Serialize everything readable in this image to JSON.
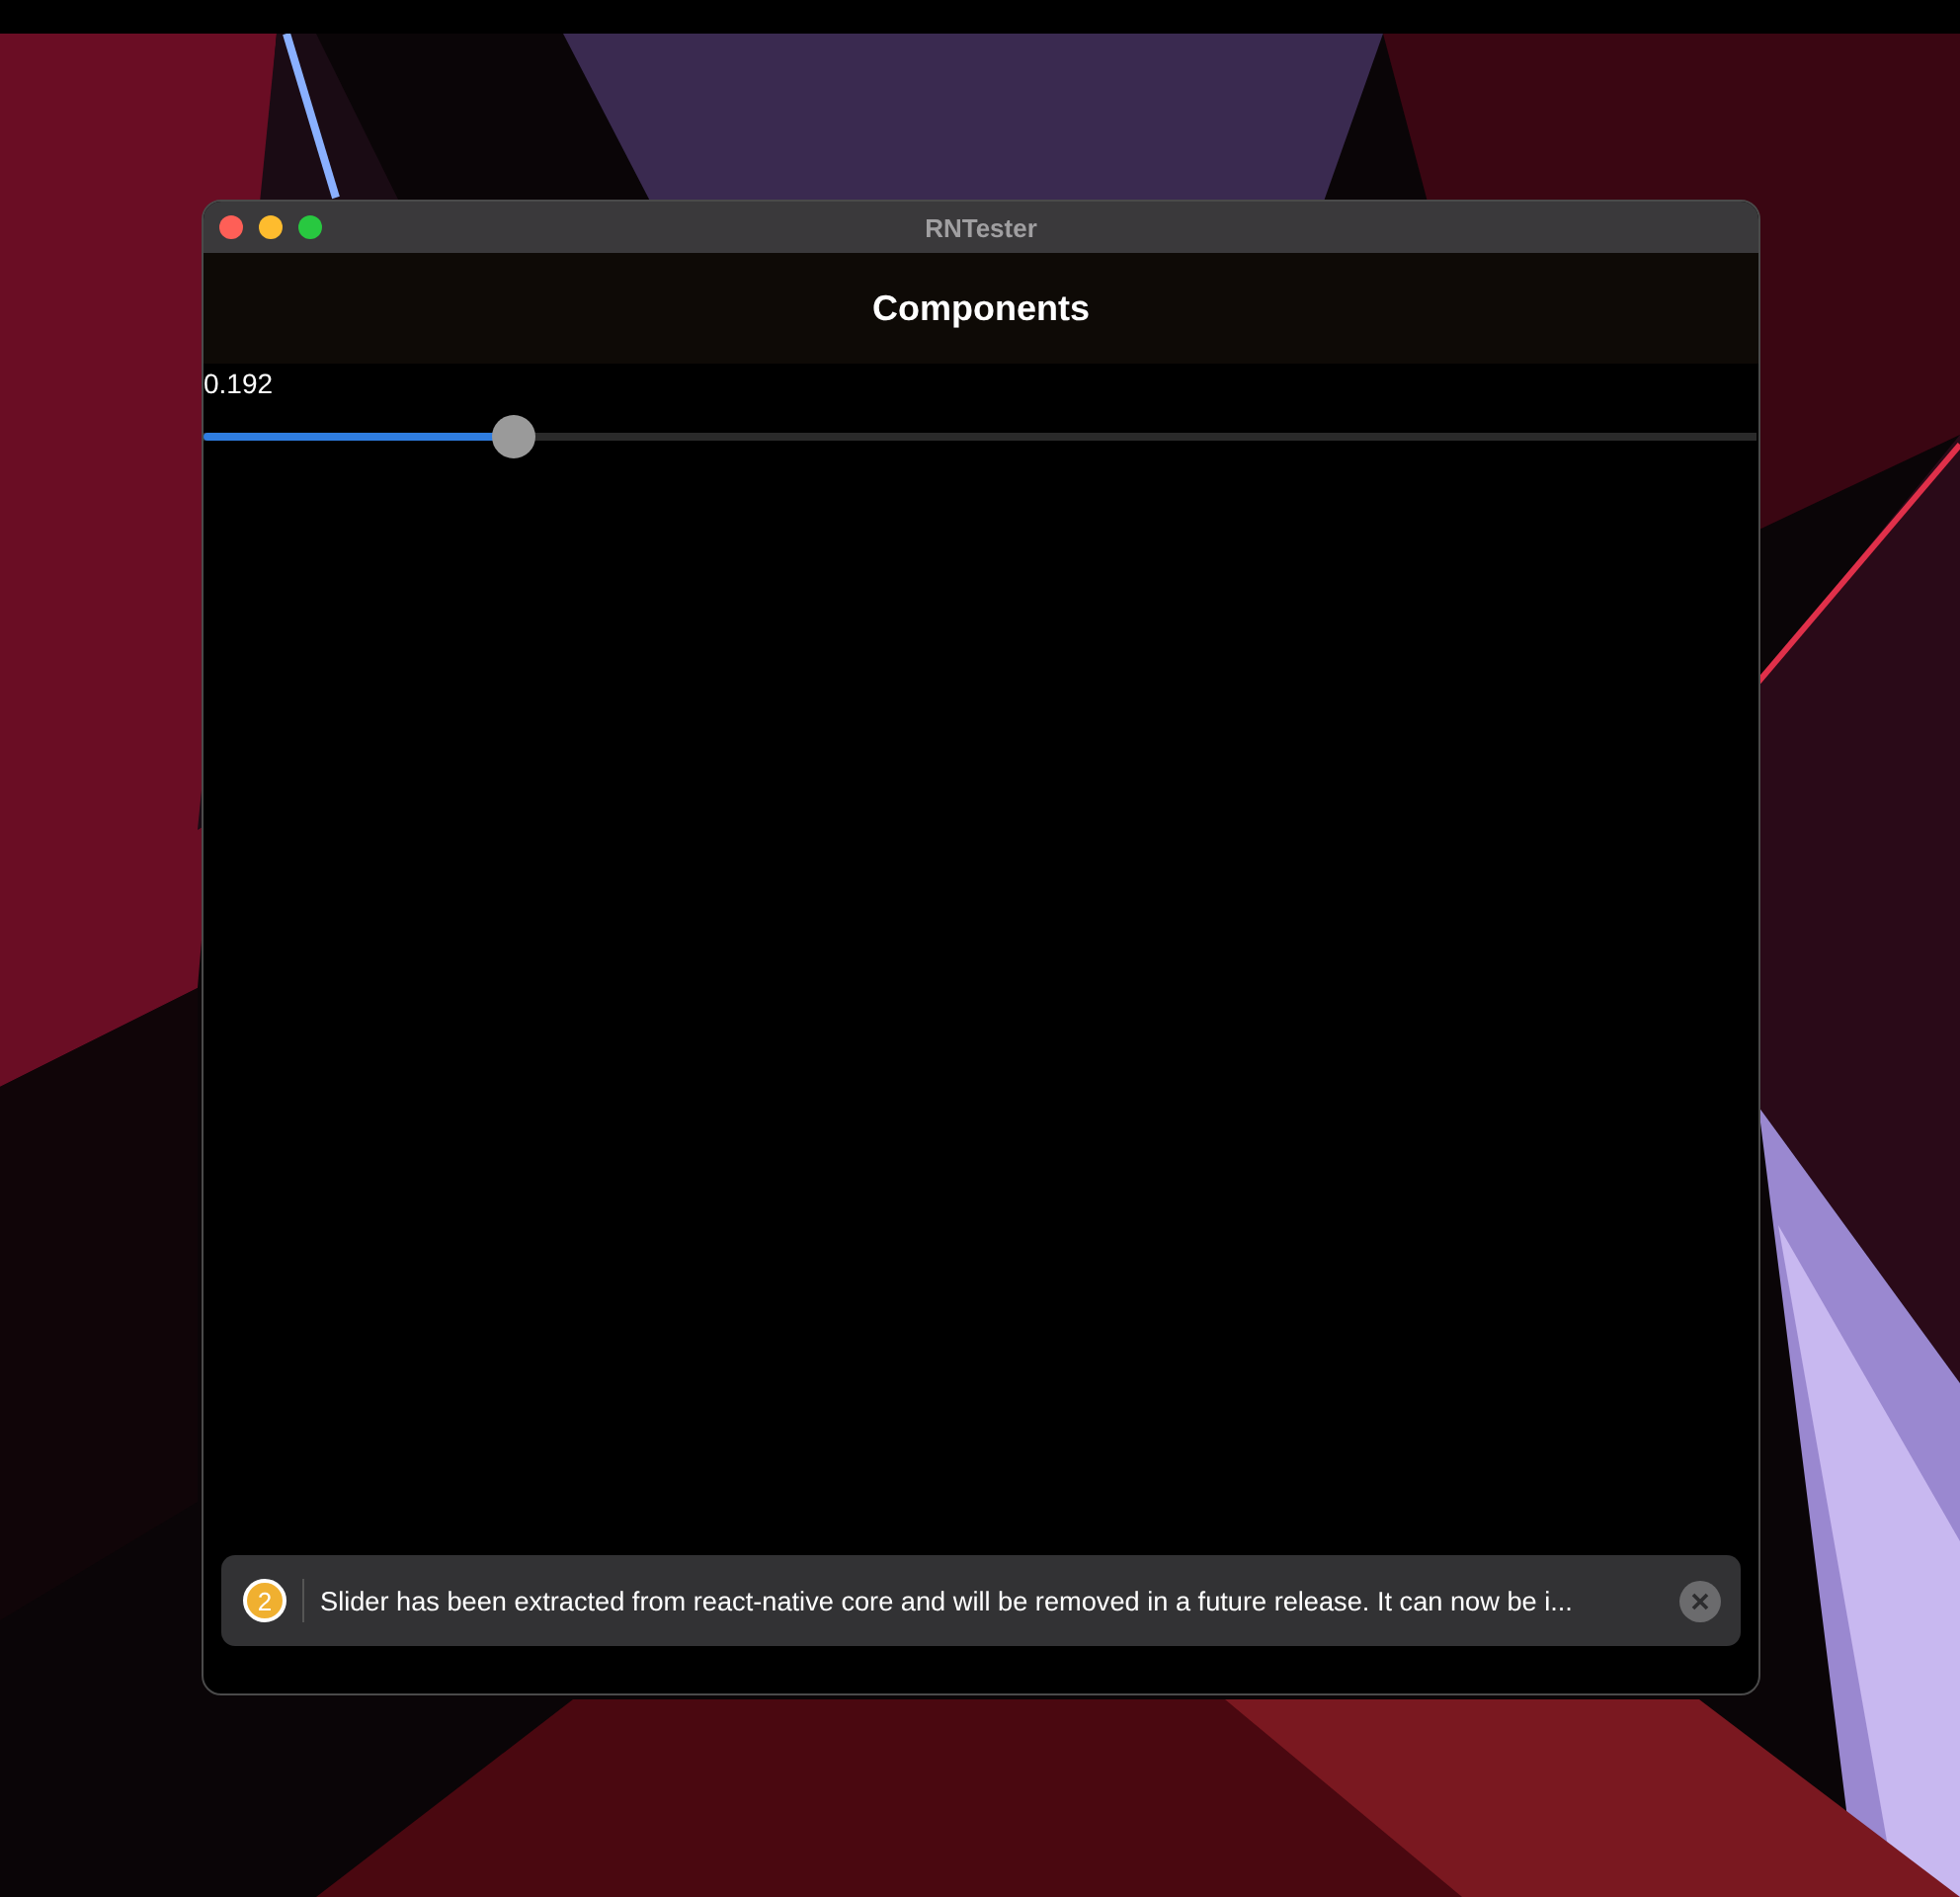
{
  "window": {
    "title": "RNTester"
  },
  "header": {
    "title": "Components"
  },
  "slider": {
    "reading": "0.192",
    "level": 0.2
  },
  "warning": {
    "count": "2",
    "message": "Slider has been extracted from react-native core and will be removed in a future release. It can now be i..."
  }
}
